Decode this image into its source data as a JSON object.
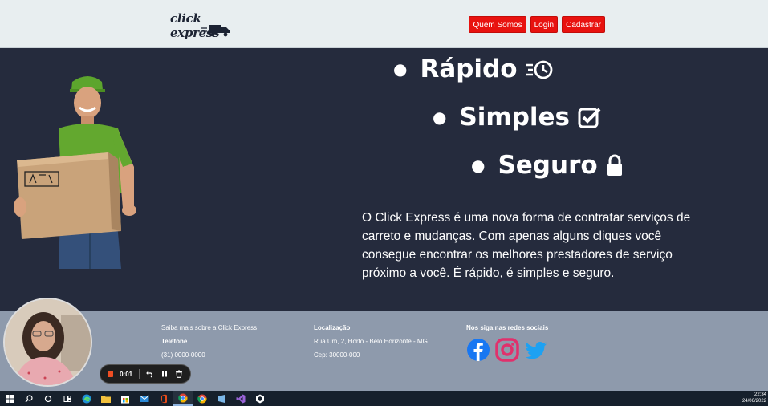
{
  "header": {
    "logo_text": "click express",
    "nav": [
      "Quem Somos",
      "Login",
      "Cadastrar"
    ]
  },
  "hero": {
    "bullets": [
      {
        "label": "Rápido",
        "icon": "fast-clock-icon"
      },
      {
        "label": "Simples",
        "icon": "checkbox-icon"
      },
      {
        "label": "Seguro",
        "icon": "lock-icon"
      }
    ],
    "description": "O Click Express é uma nova forma de contratar serviços de carreto e mudanças. Com apenas alguns cliques você consegue encontrar os melhores prestadores de serviço próximo a você. É rápido, é simples e seguro."
  },
  "footer": {
    "about": "Saiba mais sobre a Click Express",
    "phone_title": "Telefone",
    "phone": "(31) 0000-0000",
    "location_title": "Localização",
    "address": "Rua Um, 2, Horto - Belo Horizonte - MG",
    "cep": "Cep: 30000-000",
    "social_title": "Nos siga nas redes sociais",
    "social_icons": [
      "facebook-icon",
      "instagram-icon",
      "twitter-icon"
    ]
  },
  "recorder": {
    "time": "0:01"
  },
  "taskbar": {
    "time": "22:34",
    "date": "24/06/2022"
  },
  "colors": {
    "header_bg": "#e8eef0",
    "hero_bg": "#252b3d",
    "footer_bg": "#8e9aac",
    "nav_button": "#e8120f",
    "facebook": "#1877f2",
    "instagram": "#e1306c",
    "twitter": "#1da1f2"
  }
}
